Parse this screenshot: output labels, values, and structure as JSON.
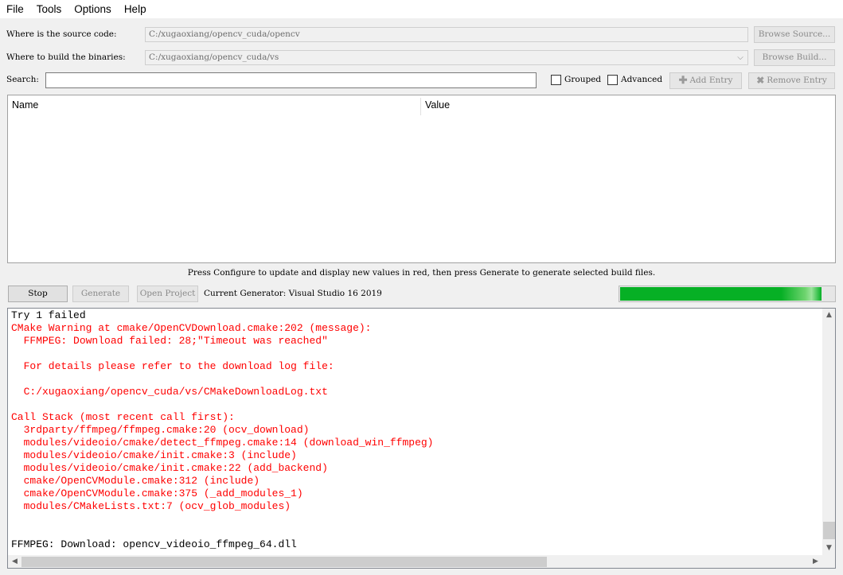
{
  "menu": [
    "File",
    "Tools",
    "Options",
    "Help"
  ],
  "source": {
    "label": "Where is the source code:",
    "value": "C:/xugaoxiang/opencv_cuda/opencv",
    "browse_label": "Browse Source..."
  },
  "build": {
    "label": "Where to build the binaries:",
    "value": "C:/xugaoxiang/opencv_cuda/vs",
    "browse_label": "Browse Build..."
  },
  "search": {
    "label": "Search:",
    "value": "",
    "grouped_label": "Grouped",
    "advanced_label": "Advanced",
    "add_entry_label": "Add Entry",
    "remove_entry_label": "Remove Entry"
  },
  "table": {
    "columns": [
      "Name",
      "Value"
    ]
  },
  "hint": "Press Configure to update and display new values in red,  then press Generate to generate selected build files.",
  "actions": {
    "stop_label": "Stop",
    "generate_label": "Generate",
    "open_project_label": "Open Project",
    "generator_text": "Current Generator: Visual Studio 16 2019"
  },
  "progress": {
    "value": 0.94,
    "color": "#06b025"
  },
  "output": {
    "lines": [
      {
        "text": "Try 1 failed",
        "color": "black"
      },
      {
        "text": "CMake Warning at cmake/OpenCVDownload.cmake:202 (message):",
        "color": "red"
      },
      {
        "text": "  FFMPEG: Download failed: 28;\"Timeout was reached\"",
        "color": "red"
      },
      {
        "text": "",
        "color": "red"
      },
      {
        "text": "  For details please refer to the download log file:",
        "color": "red"
      },
      {
        "text": "",
        "color": "red"
      },
      {
        "text": "  C:/xugaoxiang/opencv_cuda/vs/CMakeDownloadLog.txt",
        "color": "red"
      },
      {
        "text": "",
        "color": "red"
      },
      {
        "text": "Call Stack (most recent call first):",
        "color": "red"
      },
      {
        "text": "  3rdparty/ffmpeg/ffmpeg.cmake:20 (ocv_download)",
        "color": "red"
      },
      {
        "text": "  modules/videoio/cmake/detect_ffmpeg.cmake:14 (download_win_ffmpeg)",
        "color": "red"
      },
      {
        "text": "  modules/videoio/cmake/init.cmake:3 (include)",
        "color": "red"
      },
      {
        "text": "  modules/videoio/cmake/init.cmake:22 (add_backend)",
        "color": "red"
      },
      {
        "text": "  cmake/OpenCVModule.cmake:312 (include)",
        "color": "red"
      },
      {
        "text": "  cmake/OpenCVModule.cmake:375 (_add_modules_1)",
        "color": "red"
      },
      {
        "text": "  modules/CMakeLists.txt:7 (ocv_glob_modules)",
        "color": "red"
      },
      {
        "text": "",
        "color": "red"
      },
      {
        "text": "",
        "color": "red"
      },
      {
        "text": "FFMPEG: Download: opencv_videoio_ffmpeg_64.dll",
        "color": "black"
      }
    ]
  },
  "colors": {
    "error_text": "#ff0000",
    "progress": "#06b025"
  }
}
